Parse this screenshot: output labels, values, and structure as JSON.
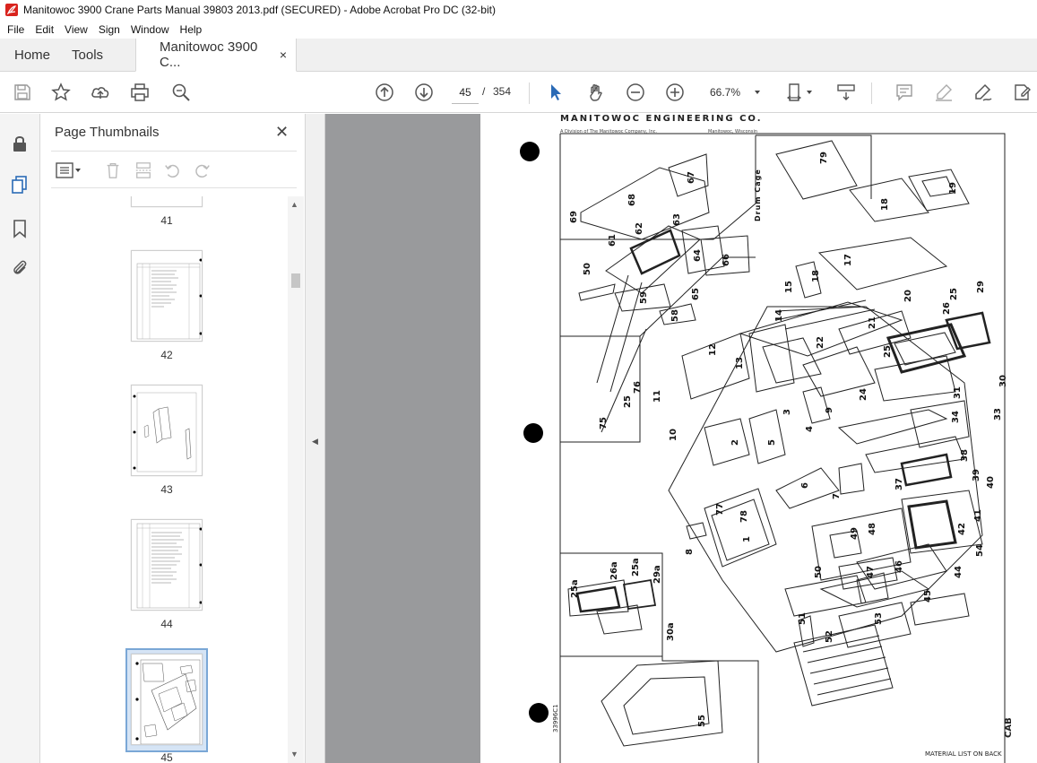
{
  "window": {
    "title": "Manitowoc 3900 Crane Parts Manual 39803 2013.pdf (SECURED) - Adobe Acrobat Pro DC (32-bit)"
  },
  "menu": [
    "File",
    "Edit",
    "View",
    "Sign",
    "Window",
    "Help"
  ],
  "tabs": {
    "home": "Home",
    "tools": "Tools",
    "document": "Manitowoc 3900 C...",
    "close": "×"
  },
  "toolbar": {
    "current_page": "45",
    "page_separator": "/",
    "total_pages": "354",
    "zoom": "66.7%",
    "icons": [
      "save-icon",
      "star-icon",
      "upload-icon",
      "print-icon",
      "search-zoom-icon",
      "page-up-icon",
      "page-down-icon",
      "select-arrow-icon",
      "hand-icon",
      "zoom-out-icon",
      "zoom-in-icon",
      "fit-page-icon",
      "scroll-mode-icon",
      "comment-icon",
      "highlight-icon",
      "sign-icon",
      "edit-pdf-icon"
    ]
  },
  "panel": {
    "title": "Page Thumbnails",
    "close": "✕",
    "thumbnails": [
      {
        "label": "41"
      },
      {
        "label": "42"
      },
      {
        "label": "43"
      },
      {
        "label": "44"
      },
      {
        "label": "45",
        "selected": true
      }
    ]
  },
  "document": {
    "header": "MANITOWOC ENGINEERING CO.",
    "sub_left": "A Division of The Manitowoc Company, Inc.",
    "sub_right": "Manitowoc, Wisconsin",
    "section_label": "Drum Cage",
    "footer_right": "MATERIAL LIST ON BACK",
    "footer_left": "33996C1",
    "corner_label": "CAB",
    "part_numbers": [
      "1",
      "2",
      "3",
      "4",
      "5",
      "6",
      "7",
      "8",
      "9",
      "10",
      "11",
      "12",
      "13",
      "14",
      "15",
      "17",
      "18",
      "19",
      "20",
      "21",
      "22",
      "24",
      "25",
      "26",
      "29",
      "30",
      "31",
      "33",
      "34",
      "37",
      "38",
      "39",
      "40",
      "41",
      "42",
      "44",
      "45",
      "46",
      "47",
      "48",
      "49",
      "50",
      "51",
      "52",
      "53",
      "54",
      "55",
      "58",
      "59",
      "61",
      "62",
      "63",
      "64",
      "65",
      "66",
      "67",
      "68",
      "69",
      "75",
      "76",
      "77",
      "78",
      "79",
      "25a",
      "26a",
      "29a",
      "30a"
    ]
  },
  "colors": {
    "accent": "#2a6ab6",
    "doc_bg": "#999a9c",
    "selected_thumb": "#d5e4f5"
  }
}
